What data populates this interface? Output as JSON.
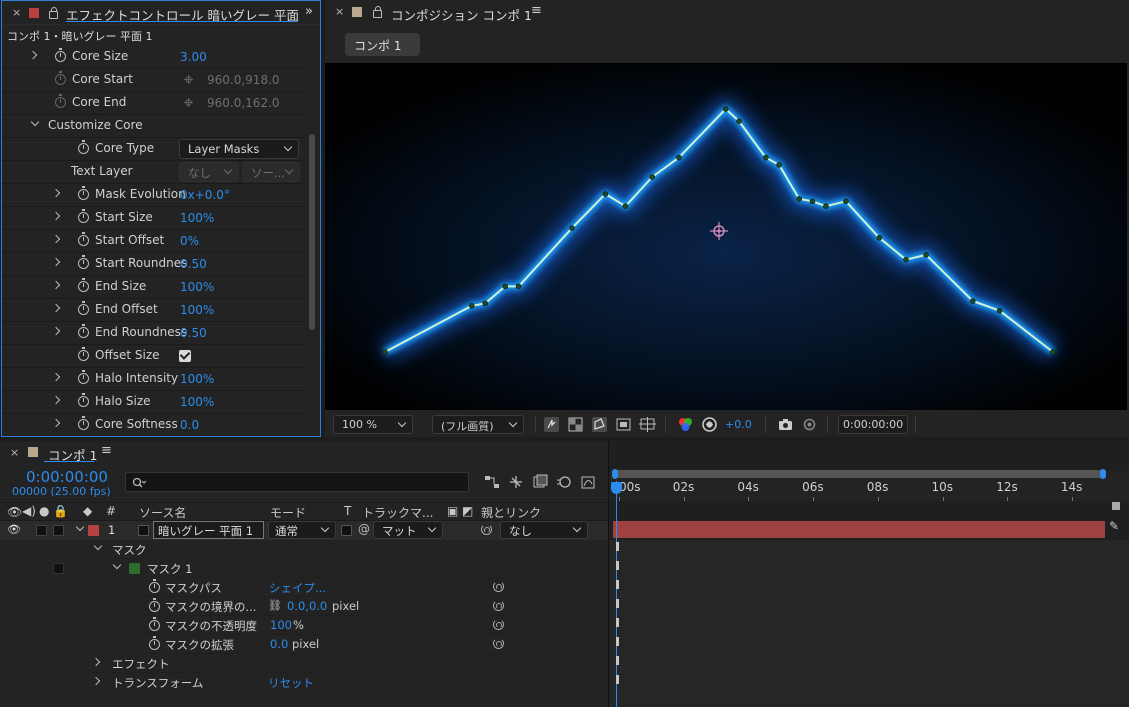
{
  "colors": {
    "accent": "#2d8ceb",
    "layer_red": "#b94040",
    "layer_bar": "#a04242",
    "mask_green": "#2e6b2e",
    "comp_swatch": "#b8a890",
    "glow": "#1e90ff"
  },
  "effect_controls": {
    "title": "エフェクトコントロール 暗いグレー 平面 1",
    "breadcrumb": "コンポ 1・暗いグレー 平面 1",
    "properties": [
      {
        "name": "Core Size",
        "value": "3.00"
      },
      {
        "name": "Core Start",
        "value": "960.0,918.0"
      },
      {
        "name": "Core End",
        "value": "960.0,162.0"
      },
      {
        "name": "Customize Core",
        "value": ""
      },
      {
        "name": "Core Type",
        "value": "Layer Masks"
      },
      {
        "name": "Text Layer",
        "value_a": "なし",
        "value_b": "ソー..."
      },
      {
        "name": "Mask Evolution",
        "value": "0x+0.0°"
      },
      {
        "name": "Start Size",
        "value": "100%"
      },
      {
        "name": "Start Offset",
        "value": "0%"
      },
      {
        "name": "Start Roundnes",
        "value": "0.50"
      },
      {
        "name": "End Size",
        "value": "100%"
      },
      {
        "name": "End Offset",
        "value": "100%"
      },
      {
        "name": "End Roundness",
        "value": "0.50"
      },
      {
        "name": "Offset Size",
        "value": "checked"
      },
      {
        "name": "Halo Intensity",
        "value": "100%"
      },
      {
        "name": "Halo Size",
        "value": "100%"
      },
      {
        "name": "Core Softness",
        "value": "0.0"
      }
    ]
  },
  "composition": {
    "title": "コンポジション コンポ 1",
    "tab": "コンポ 1",
    "toolbar": {
      "zoom": "100 %",
      "quality": "(フル画質)",
      "exposure": "+0.0",
      "timecode": "0:00:00:00"
    },
    "mask_path_points": [
      [
        0.0,
        0.0
      ],
      [
        0.13,
        0.19
      ],
      [
        0.15,
        0.2
      ],
      [
        0.18,
        0.27
      ],
      [
        0.2,
        0.27
      ],
      [
        0.28,
        0.51
      ],
      [
        0.33,
        0.65
      ],
      [
        0.36,
        0.6
      ],
      [
        0.4,
        0.72
      ],
      [
        0.44,
        0.8
      ],
      [
        0.51,
        1.0
      ],
      [
        0.53,
        0.95
      ],
      [
        0.57,
        0.8
      ],
      [
        0.59,
        0.77
      ],
      [
        0.62,
        0.63
      ],
      [
        0.64,
        0.62
      ],
      [
        0.66,
        0.6
      ],
      [
        0.69,
        0.62
      ],
      [
        0.74,
        0.47
      ],
      [
        0.78,
        0.38
      ],
      [
        0.81,
        0.4
      ],
      [
        0.88,
        0.21
      ],
      [
        0.92,
        0.17
      ],
      [
        1.0,
        0.0
      ]
    ]
  },
  "timeline": {
    "tab_title": "コンポ 1",
    "timecode": "0:00:00:00",
    "frames": "00000 (25.00 fps)",
    "search_placeholder": "",
    "columns": {
      "number": "#",
      "source_name": "ソース名",
      "mode": "モード",
      "t": "T",
      "track_matte": "トラックマ...",
      "parent": "親とリンク"
    },
    "layer": {
      "number": "1",
      "name": "暗いグレー 平面 1",
      "mode": "通常",
      "matte": "マット",
      "parent": "なし"
    },
    "rows": [
      {
        "name": "マスク",
        "value": ""
      },
      {
        "name": "マスク 1",
        "value": ""
      },
      {
        "name": "マスクパス",
        "value": "シェイプ..."
      },
      {
        "name": "マスクの境界の...",
        "value": "0.0,0.0",
        "unit": "pixel"
      },
      {
        "name": "マスクの不透明度",
        "value": "100",
        "unit": "%"
      },
      {
        "name": "マスクの拡張",
        "value": "0.0",
        "unit": "pixel"
      },
      {
        "name": "エフェクト",
        "value": ""
      },
      {
        "name": "トランスフォーム",
        "value": "リセット"
      }
    ],
    "ruler_labels": [
      "00s",
      "02s",
      "04s",
      "06s",
      "08s",
      "10s",
      "12s",
      "14s"
    ]
  }
}
